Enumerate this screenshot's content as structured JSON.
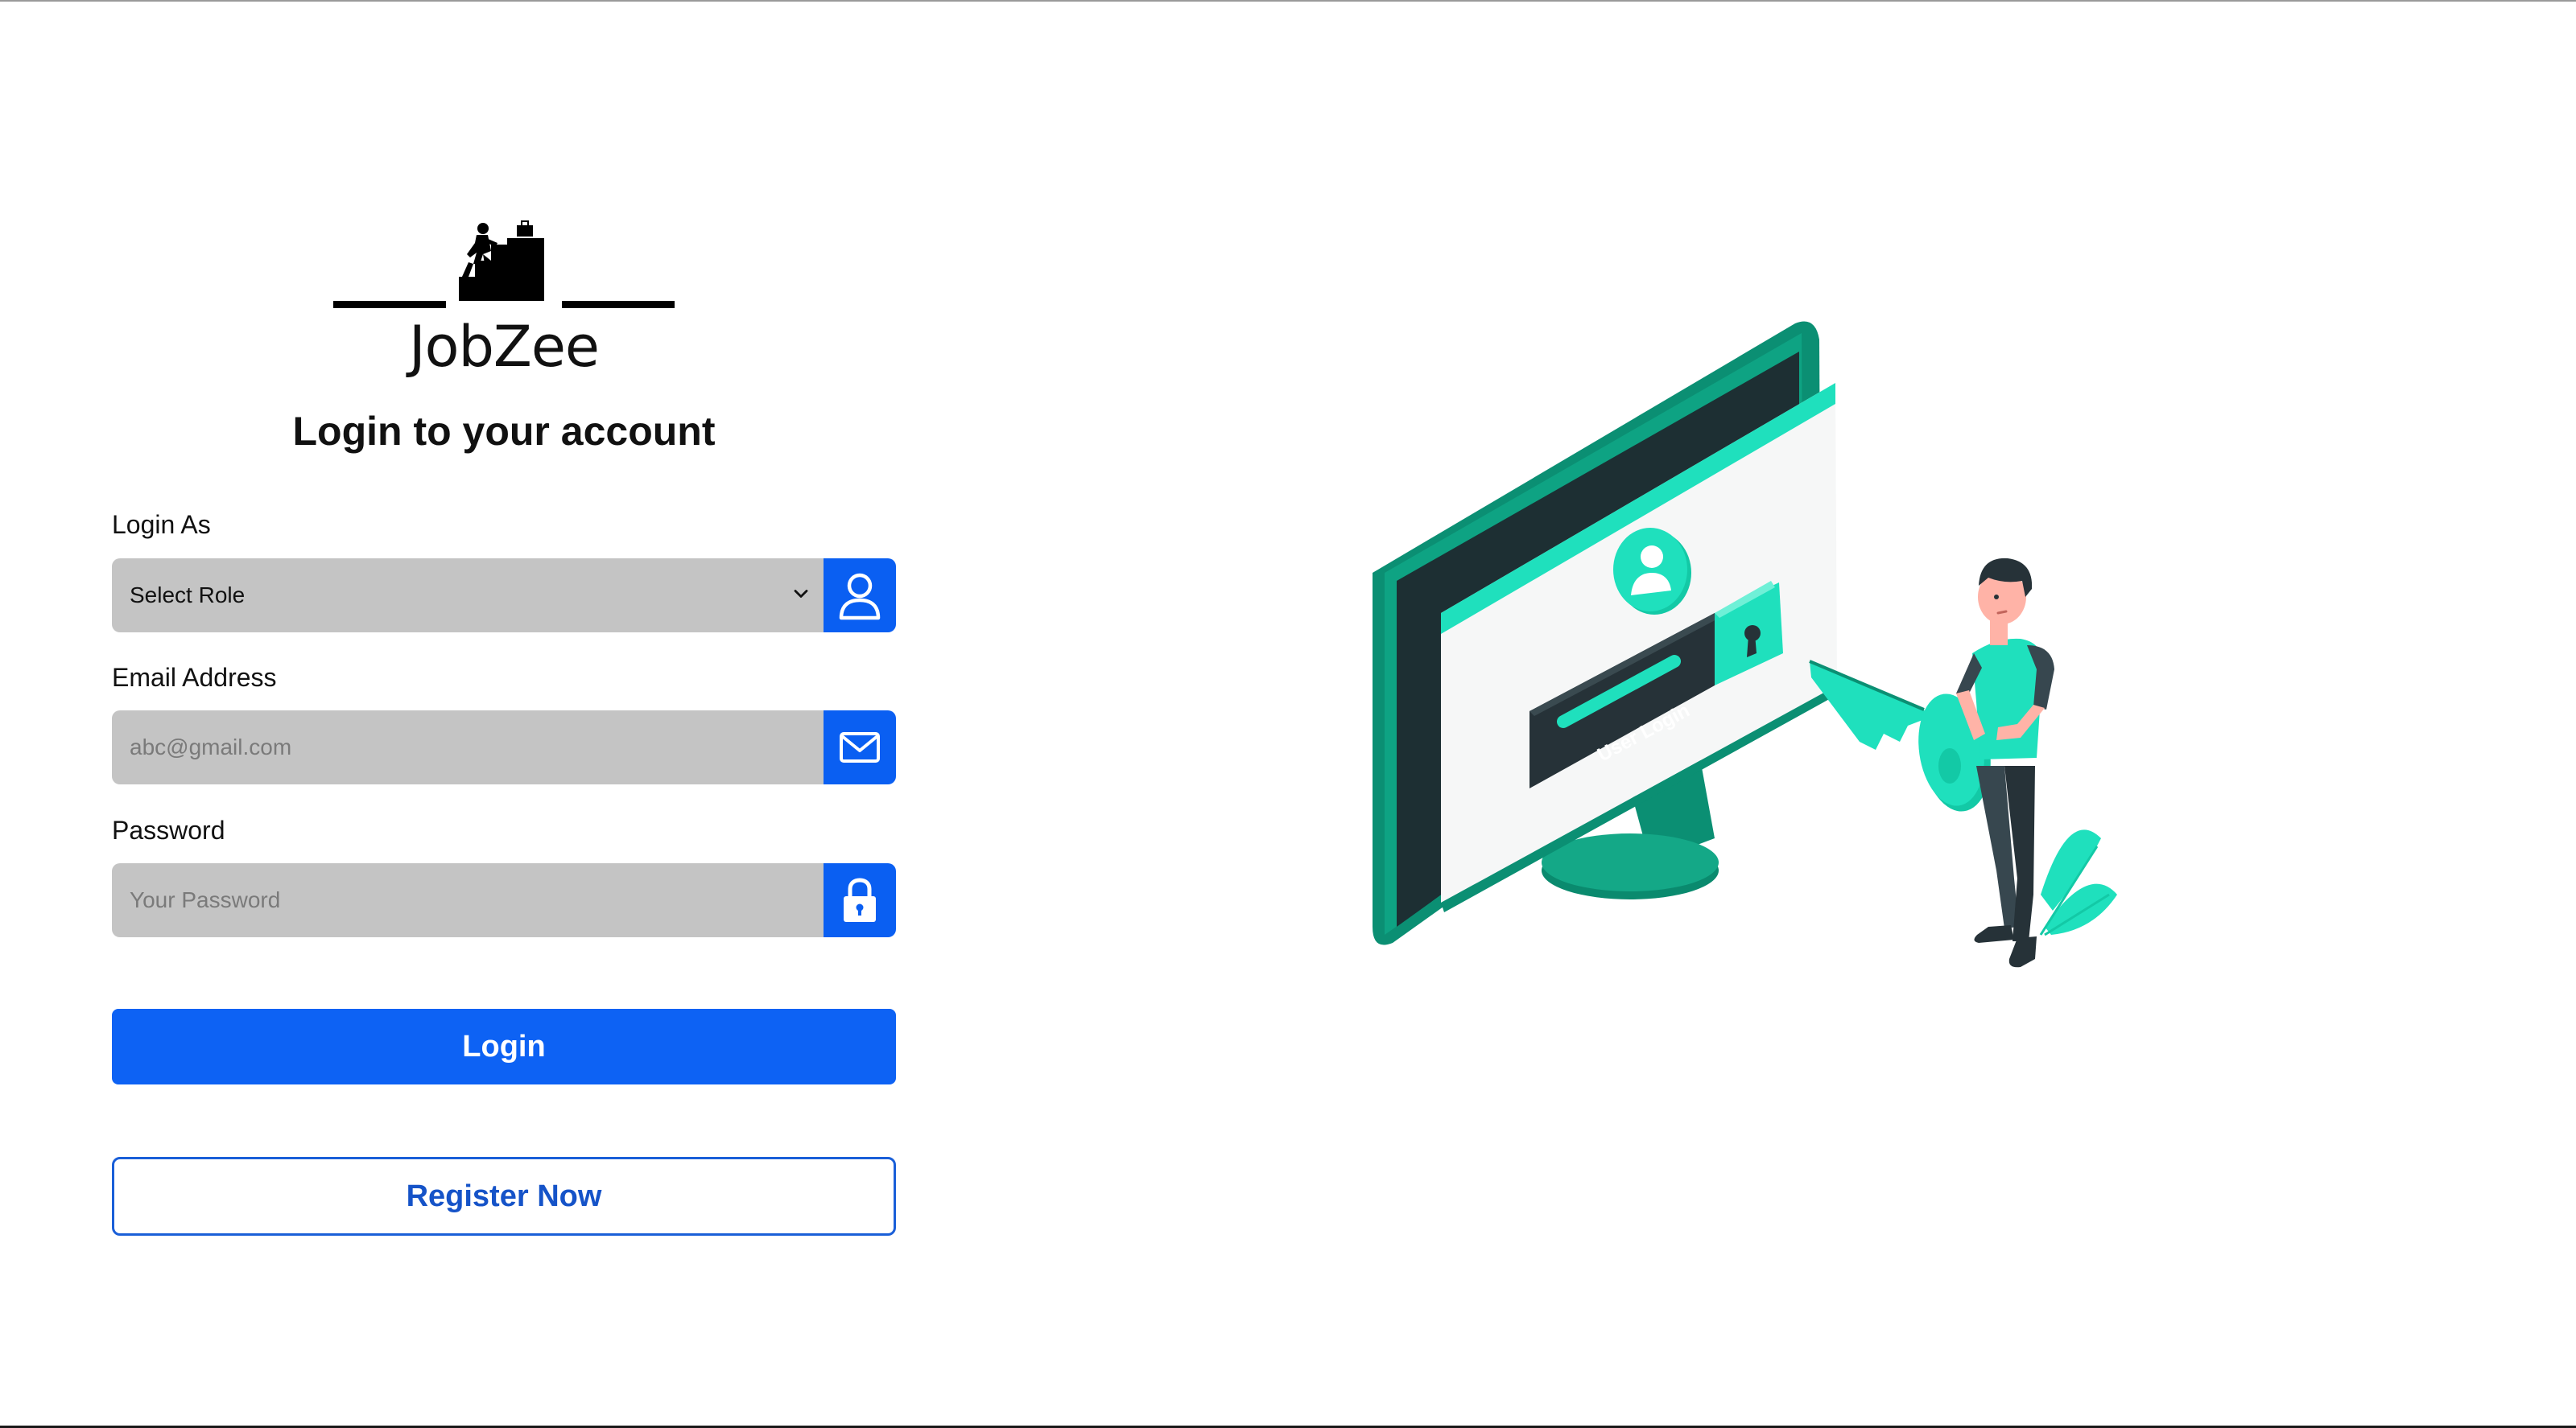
{
  "brand": {
    "name": "JobZee"
  },
  "form": {
    "title": "Login to your account",
    "role": {
      "label": "Login As",
      "selected_value": "Select Role",
      "icon": "user-icon"
    },
    "email": {
      "label": "Email Address",
      "placeholder": "abc@gmail.com",
      "value": "",
      "icon": "mail-icon"
    },
    "password": {
      "label": "Password",
      "placeholder": "Your Password",
      "value": "",
      "icon": "lock-icon"
    },
    "login_label": "Login",
    "register_label": "Register Now"
  },
  "illustration": {
    "screen_caption": "User Login"
  },
  "colors": {
    "primary": "#0d62f4",
    "input_bg": "#c4c4c4",
    "accent_teal": "#1fe0bd",
    "dark_teal": "#0d9b7d"
  }
}
